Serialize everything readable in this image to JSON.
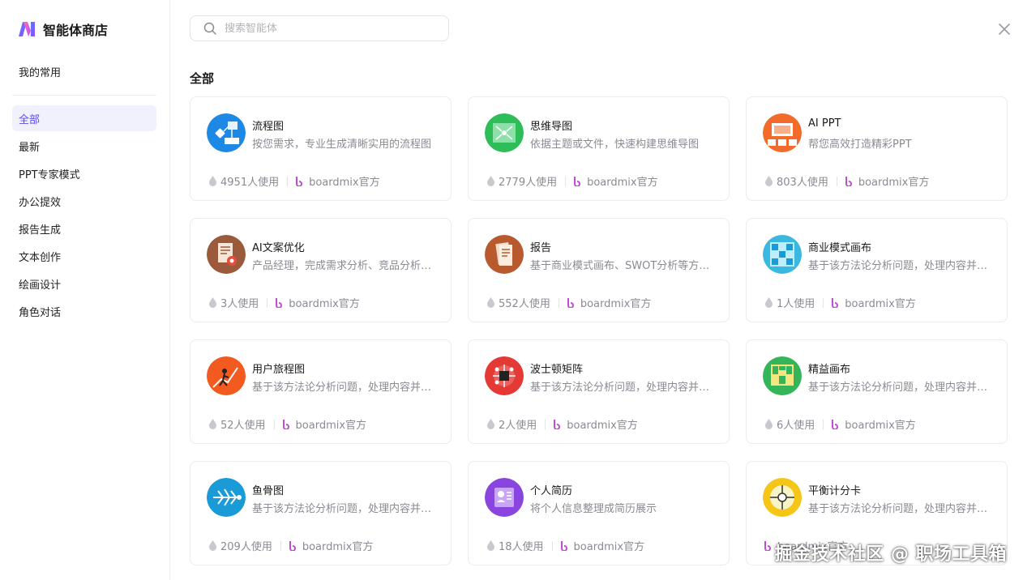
{
  "app": {
    "title": "智能体商店"
  },
  "sidebar": {
    "favorites": "我的常用",
    "items": [
      {
        "label": "全部",
        "active": true
      },
      {
        "label": "最新"
      },
      {
        "label": "PPT专家模式"
      },
      {
        "label": "办公提效"
      },
      {
        "label": "报告生成"
      },
      {
        "label": "文本创作"
      },
      {
        "label": "绘画设计"
      },
      {
        "label": "角色对话"
      }
    ]
  },
  "search": {
    "placeholder": "搜索智能体",
    "value": ""
  },
  "section": {
    "title": "全部"
  },
  "cards": [
    {
      "title": "流程图",
      "desc": "按您需求，专业生成清晰实用的流程图",
      "uses": "4951人使用",
      "author": "boardmix官方",
      "icon": "flowchart-icon",
      "color": "#1e88e5"
    },
    {
      "title": "思维导图",
      "desc": "依据主题或文件，快速构建思维导图",
      "uses": "2779人使用",
      "author": "boardmix官方",
      "icon": "mindmap-icon",
      "color": "#2ebd59"
    },
    {
      "title": "AI PPT",
      "desc": "帮您高效打造精彩PPT",
      "uses": "803人使用",
      "author": "boardmix官方",
      "icon": "ppt-icon",
      "color": "#f26b2a"
    },
    {
      "title": "AI文案优化",
      "desc": "产品经理，完成需求分析、竞品分析等工作",
      "uses": "3人使用",
      "author": "boardmix官方",
      "icon": "document-gear-icon",
      "color": "#9b5a3c"
    },
    {
      "title": "报告",
      "desc": "基于商业模式画布、SWOT分析等方法生成报告",
      "uses": "552人使用",
      "author": "boardmix官方",
      "icon": "report-icon",
      "color": "#b85a2e"
    },
    {
      "title": "商业模式画布",
      "desc": "基于该方法论分析问题，处理内容并输出结果",
      "uses": "1人使用",
      "author": "boardmix官方",
      "icon": "canvas-grid-icon",
      "color": "#3bb8e0"
    },
    {
      "title": "用户旅程图",
      "desc": "基于该方法论分析问题，处理内容并输出结果",
      "uses": "52人使用",
      "author": "boardmix官方",
      "icon": "journey-icon",
      "color": "#f35a1f"
    },
    {
      "title": "波士顿矩阵",
      "desc": "基于该方法论分析问题，处理内容并输出结果",
      "uses": "2人使用",
      "author": "boardmix官方",
      "icon": "matrix-icon",
      "color": "#e53935"
    },
    {
      "title": "精益画布",
      "desc": "基于该方法论分析问题，处理内容并输出结果",
      "uses": "6人使用",
      "author": "boardmix官方",
      "icon": "lean-canvas-icon",
      "color": "#34b55a"
    },
    {
      "title": "鱼骨图",
      "desc": "基于该方法论分析问题，处理内容并输出结果",
      "uses": "209人使用",
      "author": "boardmix官方",
      "icon": "fishbone-icon",
      "color": "#1a9bd7"
    },
    {
      "title": "个人简历",
      "desc": "将个人信息整理成简历展示",
      "uses": "18人使用",
      "author": "boardmix官方",
      "icon": "resume-icon",
      "color": "#8a44e0"
    },
    {
      "title": "平衡计分卡",
      "desc": "基于该方法论分析问题，处理内容并输出结果",
      "uses": "",
      "author": "boardmix官方",
      "icon": "scorecard-icon",
      "color": "#f5c518"
    }
  ],
  "watermark": "掘金技术社区 @ 职场工具箱"
}
